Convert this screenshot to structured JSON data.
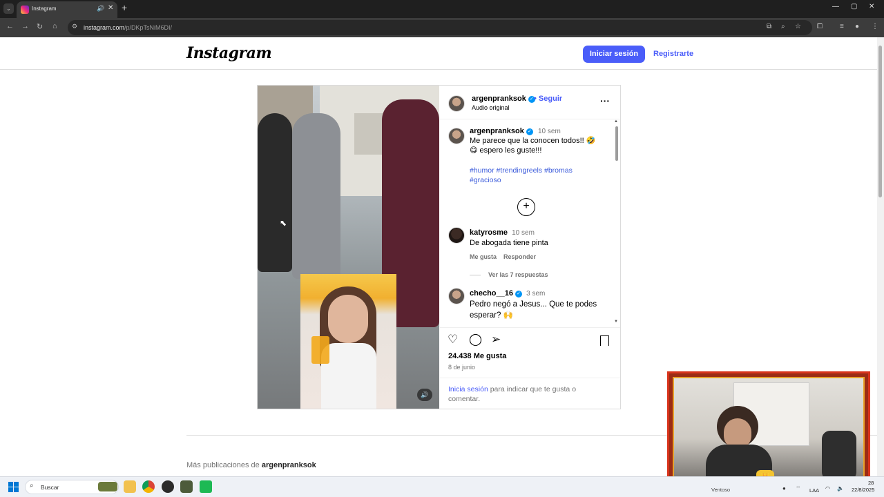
{
  "browser": {
    "tab_title": "Instagram",
    "url_domain": "instagram.com",
    "url_path": "/p/DKpTsNiM6DI/",
    "new_tab": "+",
    "tab_close": "✕"
  },
  "header": {
    "logo": "Instagram",
    "login_label": "Iniciar sesión",
    "signup_label": "Registrarte"
  },
  "post": {
    "owner": "argenpranksok",
    "follow_sep": "•",
    "follow_label": "Seguir",
    "audio": "Audio original",
    "caption_time": "10 sem",
    "caption_line1": "Me parece que la conocen todos!! 🤣",
    "caption_line2": "😋 espero les guste!!!",
    "hashtags_line1": "#humor #trendingreels #bromas",
    "hashtags_line2": "#gracioso",
    "comments": [
      {
        "user": "katyrosme",
        "time": "10 sem",
        "text": "De abogada tiene pinta",
        "like_label": "Me gusta",
        "reply_label": "Responder",
        "replies_label": "Ver las 7 respuestas"
      },
      {
        "user": "checho__16",
        "time": "3 sem",
        "text_line1": "Pedro negó a Jesus... Que te podes",
        "text_line2": "esperar? 🙌"
      }
    ],
    "likes": "24.438 Me gusta",
    "date": "8 de junio",
    "login_link": "Inicia sesión",
    "login_rest_1": " para indicar que te gusta o",
    "login_rest_2": "comentar."
  },
  "more_posts": {
    "prefix": "Más publicaciones de ",
    "user": "argenpranksok"
  },
  "taskbar": {
    "search_placeholder": "Buscar",
    "weather": "Ventoso",
    "lang": "LAA",
    "date": "22/8/2025",
    "time": "28"
  },
  "icons": {
    "heart": "heart-icon",
    "comment": "comment-icon",
    "share": "send-icon",
    "save": "bookmark-icon",
    "more": "more-icon",
    "mute": "speaker-icon"
  },
  "colors": {
    "accent": "#4a5df9",
    "verified": "#0095f6",
    "webcam_border": "#d8341c"
  }
}
